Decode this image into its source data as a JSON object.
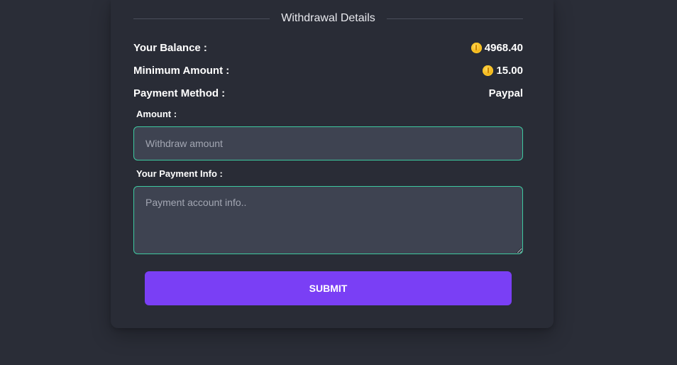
{
  "header": {
    "title": "Withdrawal Details"
  },
  "summary": {
    "balance_label": "Your Balance :",
    "balance_value": "4968.40",
    "minimum_label": "Minimum Amount :",
    "minimum_value": "15.00",
    "method_label": "Payment Method :",
    "method_value": "Paypal",
    "coin_icon": "gold-coin-icon"
  },
  "form": {
    "amount_label": "Amount :",
    "amount_placeholder": "Withdraw amount",
    "amount_value": "",
    "payment_info_label": "Your Payment Info :",
    "payment_info_placeholder": "Payment account info..",
    "payment_info_value": "",
    "submit_label": "SUBMIT"
  },
  "colors": {
    "background": "#2a2d37",
    "input_background": "#3e4351",
    "input_border": "#3ec9a0",
    "button": "#7a3ff5",
    "coin": "#f2b417"
  }
}
